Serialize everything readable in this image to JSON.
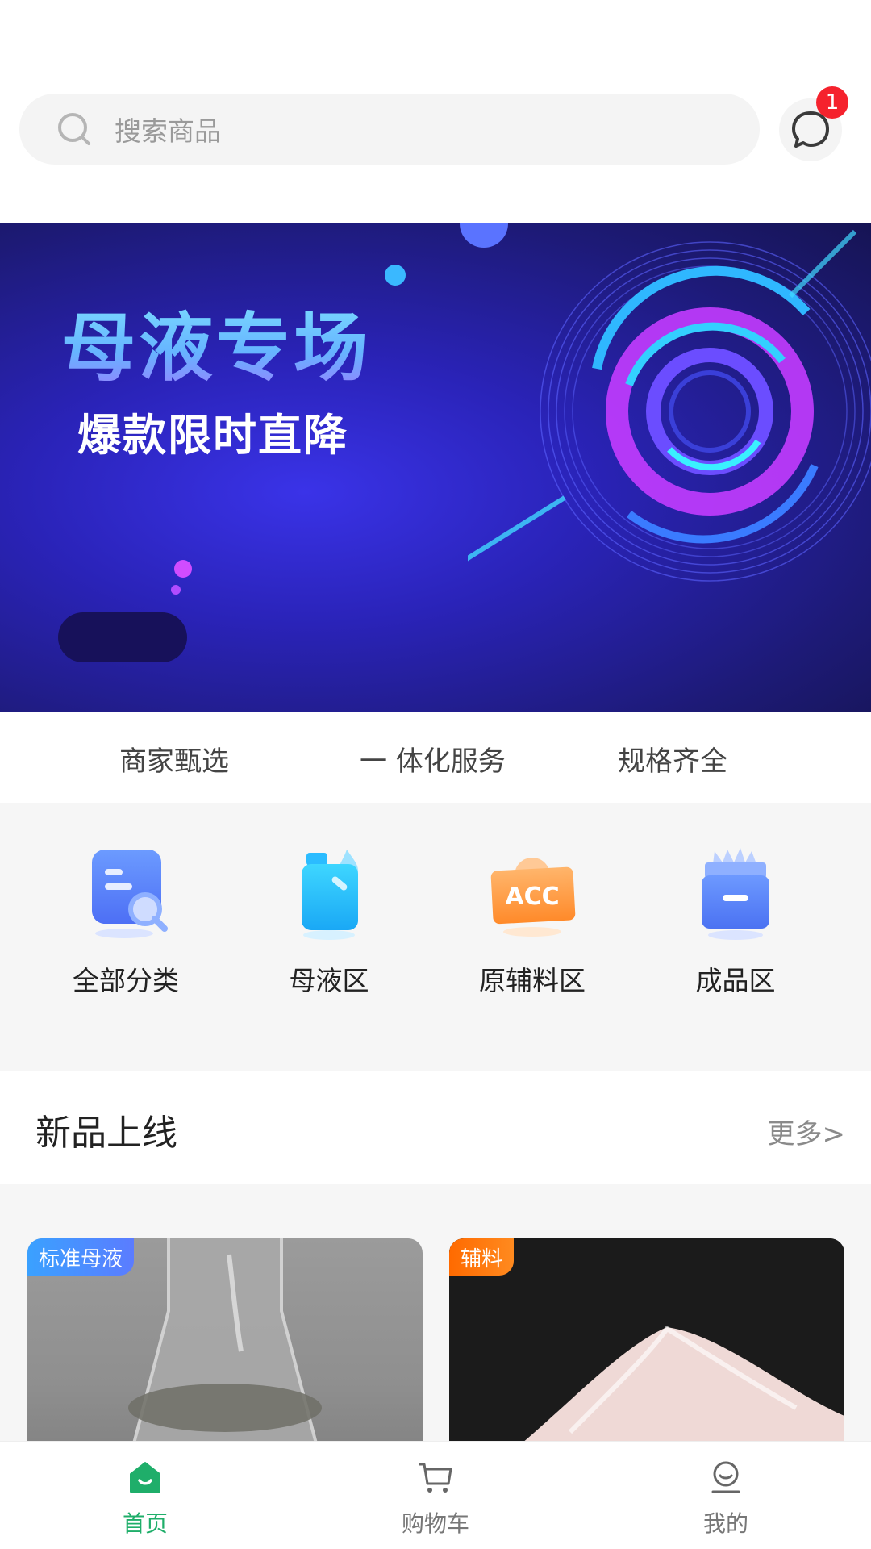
{
  "search": {
    "placeholder": "搜索商品",
    "message_badge": "1"
  },
  "banner": {
    "title": "母液专场",
    "subtitle": "爆款限时直降"
  },
  "features": [
    "商家甄选",
    "一 体化服务",
    "规格齐全"
  ],
  "categories": [
    {
      "label": "全部分类",
      "icon": "category-search-icon"
    },
    {
      "label": "母液区",
      "icon": "liquid-bottle-icon"
    },
    {
      "label": "原辅料区",
      "icon": "acc-materials-icon"
    },
    {
      "label": "成品区",
      "icon": "product-box-icon"
    }
  ],
  "new_arrivals": {
    "title": "新品上线",
    "more": "更多>"
  },
  "products": [
    {
      "tag": "标准母液"
    },
    {
      "tag": "辅料"
    }
  ],
  "bottom_nav": [
    {
      "label": "首页",
      "icon": "home-icon",
      "active": true
    },
    {
      "label": "购物车",
      "icon": "cart-icon",
      "active": false
    },
    {
      "label": "我的",
      "icon": "profile-icon",
      "active": false
    }
  ],
  "colors": {
    "accent_green": "#1fae6a",
    "badge_red": "#f5222d",
    "banner_blue": "#2a23b8"
  }
}
